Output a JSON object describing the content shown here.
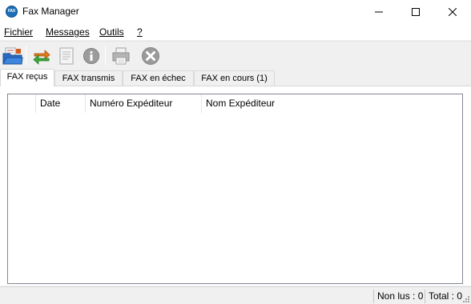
{
  "window": {
    "title": "Fax Manager",
    "icon_text": "FAX"
  },
  "menu": {
    "items": [
      {
        "label": "Fichier"
      },
      {
        "label": "Messages"
      },
      {
        "label": "Outils"
      },
      {
        "label": "?"
      }
    ]
  },
  "toolbar": {
    "buttons": [
      {
        "icon": "open-folder-icon"
      },
      {
        "icon": "refresh-icon"
      },
      {
        "icon": "document-icon"
      },
      {
        "icon": "info-icon"
      },
      {
        "icon": "printer-icon"
      },
      {
        "icon": "delete-icon"
      }
    ]
  },
  "tabs": [
    {
      "label": "FAX reçus",
      "active": true
    },
    {
      "label": "FAX transmis",
      "active": false
    },
    {
      "label": "FAX en échec",
      "active": false
    },
    {
      "label": "FAX en cours (1)",
      "active": false
    }
  ],
  "list": {
    "columns": [
      "",
      "Date",
      "Numéro Expéditeur",
      "Nom Expéditeur"
    ],
    "rows": []
  },
  "status": {
    "unread": "Non lus : 0",
    "total": "Total : 0"
  },
  "colors": {
    "accent": "#1b6fb8",
    "delete": "#9a9a9a"
  }
}
